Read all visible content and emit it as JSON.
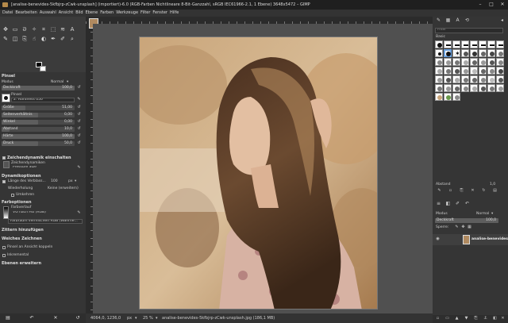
{
  "window": {
    "title": "[analise-benevides-5kfbjrp-zCwk-unsplash] (importiert)-6.0 (RGB-Farben Nichtlineare 8-Bit-Ganzzahl, sRGB IEC61966-2.1, 1 Ebene) 3648x5472 – GIMP",
    "controls": [
      "–",
      "□",
      "✕"
    ]
  },
  "menubar": [
    "Datei",
    "Bearbeiten",
    "Auswahl",
    "Ansicht",
    "Bild",
    "Ebene",
    "Farben",
    "Werkzeuge",
    "Filter",
    "Fenster",
    "Hilfe"
  ],
  "tool_options": {
    "section_title": "Pinsel",
    "mode_label": "Modus",
    "mode_value": "Normal",
    "opacity_label": "Deckkraft",
    "opacity_value": "100,0",
    "brush_label": "Pinsel",
    "brush_name": "2. Hardness 050",
    "sliders": [
      {
        "label": "Größe",
        "value": "51,00"
      },
      {
        "label": "Seitenverhältnis",
        "value": "0,00"
      },
      {
        "label": "Winkel",
        "value": "0,00"
      },
      {
        "label": "Abstand",
        "value": "10,0"
      },
      {
        "label": "Härte",
        "value": "100,0"
      },
      {
        "label": "Druck",
        "value": "50,0"
      }
    ],
    "dynamics_label": "Zeichendynamik einschalten",
    "dynamics_sublabel": "Zeichendynamiken",
    "dynamics_value": "Pressure Size",
    "dynamics_options_label": "Dynamikoptionen",
    "fade_length_label": "Länge des Verblass...",
    "fade_length_value": "100",
    "fade_unit": "px",
    "repeat_label": "Wiederholung",
    "repeat_value": "Keine (erweitern)",
    "reverse_label": "Umkehren",
    "color_options_label": "Farboptionen",
    "gradient_label": "Farbverlauf",
    "gradient_value": "VG nach HG (RGB)",
    "blend_color_space": "Farbraum vermischen RGB (Wahrne...",
    "jitter_label": "Zittern hinzufügen",
    "smooth_label": "Weiches Zeichnen",
    "lock_brush_label": "Pinsel an Ansicht koppeln",
    "incremental_label": "Inkremental",
    "expand_layers_label": "Ebenen erweitern"
  },
  "statusbar": {
    "coords": "4064,0, 1236,0",
    "unit": "px",
    "zoom": "25 %",
    "file_info": "analise-benevides-5kfbjrp-zCwk-unsplash.jpg (186,1 MB)"
  },
  "brushes_panel": {
    "filter_placeholder": "Filter",
    "tag_label": "Basic",
    "spacing_label": "Abstand",
    "spacing_value": "1,0"
  },
  "layers_panel": {
    "mode_label": "Modus",
    "mode_value": "Normal",
    "opacity_label": "Deckkraft",
    "opacity_value": "100,0",
    "lock_label": "Sperre:",
    "layer_name": "analise-benevides-5"
  },
  "colors": {
    "title_bg": "#1f1f1f",
    "panel_bg": "#353535",
    "canvas_bg": "#505050"
  }
}
